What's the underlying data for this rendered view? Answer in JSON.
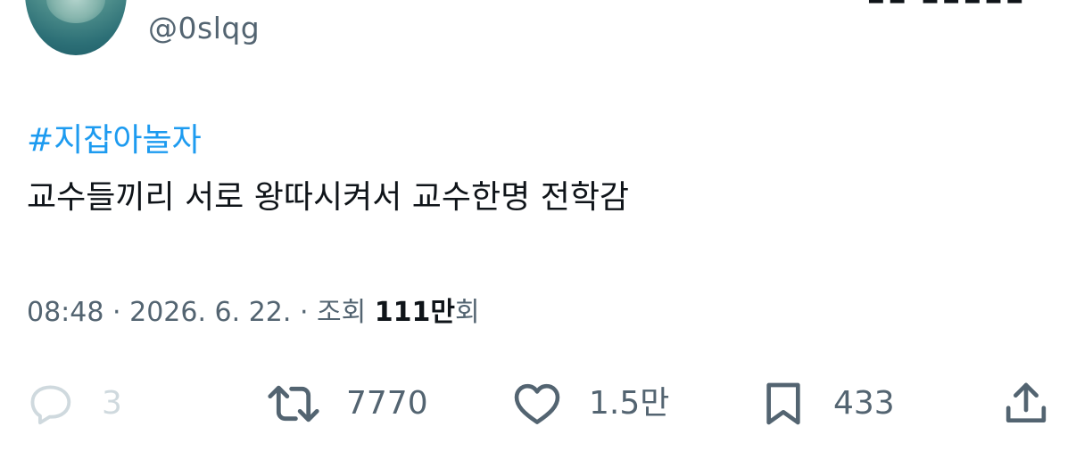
{
  "author": {
    "handle": "@0slqg",
    "top_right_partial_text": "▪▪ ▪▪▪▪▪"
  },
  "tweet": {
    "hashtag": "#지잡아놀자",
    "text": "교수들끼리 서로 왕따시켜서 교수한명 전학감"
  },
  "meta": {
    "time": "08:48",
    "separator": "·",
    "date": "2026. 6. 22.",
    "views_label": "조회",
    "views_count": "111만",
    "views_suffix": "회"
  },
  "actions": {
    "reply": {
      "icon": "reply-icon",
      "count": "3"
    },
    "retweet": {
      "icon": "retweet-icon",
      "count": "7770"
    },
    "like": {
      "icon": "heart-icon",
      "count": "1.5만"
    },
    "bookmark": {
      "icon": "bookmark-icon",
      "count": "433"
    },
    "share": {
      "icon": "share-icon"
    }
  },
  "colors": {
    "link": "#1d9bf0",
    "secondary_text": "#536471",
    "primary_text": "#0f1419",
    "disabled": "#cfd9de"
  }
}
